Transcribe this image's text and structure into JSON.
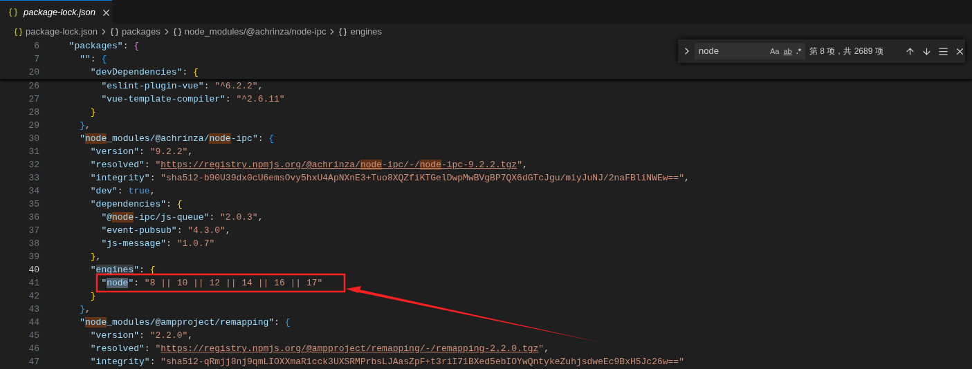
{
  "tab": {
    "label": "package-lock.json",
    "preview": true,
    "selected": true
  },
  "breadcrumbs": [
    {
      "label": "package-lock.json",
      "kind": "file"
    },
    {
      "label": "packages",
      "kind": "object"
    },
    {
      "label": "node_modules/@achrinza/node-ipc",
      "kind": "object"
    },
    {
      "label": "engines",
      "kind": "object"
    }
  ],
  "find_widget": {
    "value": "node",
    "options": [
      {
        "label": "Aa",
        "kind": "case",
        "on": false
      },
      {
        "label": "ab",
        "kind": "word",
        "on": false
      },
      {
        "label": ".*",
        "kind": "regex",
        "on": false
      }
    ],
    "result": "第 8 项，共 2689 项"
  },
  "sticky_lines": [
    {
      "number": "6",
      "active": false,
      "tokens": [
        {
          "kind": "key",
          "text": "  \"packages\""
        },
        {
          "kind": "punct",
          "text": ": "
        },
        {
          "kind": "brace",
          "text": "{",
          "color": "#da70d6"
        }
      ]
    },
    {
      "number": "7",
      "active": false,
      "tokens": [
        {
          "kind": "key",
          "text": "    \"\""
        },
        {
          "kind": "punct",
          "text": ": "
        },
        {
          "kind": "brace",
          "text": "{",
          "color": "#179fff"
        }
      ]
    },
    {
      "number": "20",
      "active": false,
      "tokens": [
        {
          "kind": "key",
          "text": "      \"devDependencies\""
        },
        {
          "kind": "punct",
          "text": ": "
        },
        {
          "kind": "brace",
          "text": "{",
          "color": "#ffd700"
        }
      ]
    }
  ],
  "lines": [
    {
      "number": "26",
      "active": false,
      "tokens": [
        {
          "kind": "key",
          "text": "        \"eslint-plugin-vue\""
        },
        {
          "kind": "punct",
          "text": ": "
        },
        {
          "kind": "string",
          "text": "\"^6.2.2\""
        },
        {
          "kind": "punct",
          "text": ","
        }
      ]
    },
    {
      "number": "27",
      "active": false,
      "tokens": [
        {
          "kind": "key",
          "text": "        \"vue-template-compiler\""
        },
        {
          "kind": "punct",
          "text": ": "
        },
        {
          "kind": "string",
          "text": "\"^2.6.11\""
        }
      ]
    },
    {
      "number": "28",
      "active": false,
      "tokens": [
        {
          "kind": "brace",
          "text": "      }",
          "color": "#ffd700"
        }
      ]
    },
    {
      "number": "29",
      "active": false,
      "tokens": [
        {
          "kind": "brace",
          "text": "    }",
          "color": "#179fff"
        },
        {
          "kind": "punct",
          "text": ","
        }
      ]
    },
    {
      "number": "30",
      "active": false,
      "tokens": [
        {
          "kind": "key",
          "text": "    \""
        },
        {
          "kind": "key",
          "text": "node",
          "match": true
        },
        {
          "kind": "key",
          "text": "_modules/@achrinza/"
        },
        {
          "kind": "key",
          "text": "node",
          "match": true
        },
        {
          "kind": "key",
          "text": "-ipc\""
        },
        {
          "kind": "punct",
          "text": ": "
        },
        {
          "kind": "brace",
          "text": "{",
          "color": "#179fff"
        }
      ]
    },
    {
      "number": "31",
      "active": false,
      "tokens": [
        {
          "kind": "key",
          "text": "      \"version\""
        },
        {
          "kind": "punct",
          "text": ": "
        },
        {
          "kind": "string",
          "text": "\"9.2.2\""
        },
        {
          "kind": "punct",
          "text": ","
        }
      ]
    },
    {
      "number": "32",
      "active": false,
      "tokens": [
        {
          "kind": "key",
          "text": "      \"resolved\""
        },
        {
          "kind": "punct",
          "text": ": "
        },
        {
          "kind": "string",
          "text": "\""
        },
        {
          "kind": "link",
          "text": "https://registry.npmjs.org/@achrinza/"
        },
        {
          "kind": "link",
          "text": "node",
          "match": true
        },
        {
          "kind": "link",
          "text": "-ipc/-/"
        },
        {
          "kind": "link",
          "text": "node",
          "match": true
        },
        {
          "kind": "link",
          "text": "-ipc-9.2.2.tgz"
        },
        {
          "kind": "string",
          "text": "\""
        },
        {
          "kind": "punct",
          "text": ","
        }
      ]
    },
    {
      "number": "33",
      "active": false,
      "tokens": [
        {
          "kind": "key",
          "text": "      \"integrity\""
        },
        {
          "kind": "punct",
          "text": ": "
        },
        {
          "kind": "string",
          "text": "\"sha512-b90U39dx0cU6emsOvy5hxU4ApNXnE3+Tuo8XQZfiKTGelDwpMwBVgBP7QX6dGTcJgu/miyJuNJ/2naFBliNWEw==\""
        },
        {
          "kind": "punct",
          "text": ","
        }
      ]
    },
    {
      "number": "34",
      "active": false,
      "tokens": [
        {
          "kind": "key",
          "text": "      \"dev\""
        },
        {
          "kind": "punct",
          "text": ": "
        },
        {
          "kind": "bool",
          "text": "true"
        },
        {
          "kind": "punct",
          "text": ","
        }
      ]
    },
    {
      "number": "35",
      "active": false,
      "tokens": [
        {
          "kind": "key",
          "text": "      \"dependencies\""
        },
        {
          "kind": "punct",
          "text": ": "
        },
        {
          "kind": "brace",
          "text": "{",
          "color": "#ffd700"
        }
      ]
    },
    {
      "number": "36",
      "active": false,
      "tokens": [
        {
          "kind": "key",
          "text": "        \"@"
        },
        {
          "kind": "key",
          "text": "node",
          "match": true
        },
        {
          "kind": "key",
          "text": "-ipc/js-queue\""
        },
        {
          "kind": "punct",
          "text": ": "
        },
        {
          "kind": "string",
          "text": "\"2.0.3\""
        },
        {
          "kind": "punct",
          "text": ","
        }
      ]
    },
    {
      "number": "37",
      "active": false,
      "tokens": [
        {
          "kind": "key",
          "text": "        \"event-pubsub\""
        },
        {
          "kind": "punct",
          "text": ": "
        },
        {
          "kind": "string",
          "text": "\"4.3.0\""
        },
        {
          "kind": "punct",
          "text": ","
        }
      ]
    },
    {
      "number": "38",
      "active": false,
      "tokens": [
        {
          "kind": "key",
          "text": "        \"js-message\""
        },
        {
          "kind": "punct",
          "text": ": "
        },
        {
          "kind": "string",
          "text": "\"1.0.7\""
        }
      ]
    },
    {
      "number": "39",
      "active": false,
      "tokens": [
        {
          "kind": "brace",
          "text": "      }",
          "color": "#ffd700"
        },
        {
          "kind": "punct",
          "text": ","
        }
      ]
    },
    {
      "number": "40",
      "active": true,
      "tokens": [
        {
          "kind": "key",
          "text": "      \""
        },
        {
          "kind": "key",
          "text": "engines",
          "selected": true
        },
        {
          "kind": "key",
          "text": "\""
        },
        {
          "kind": "punct",
          "text": ": "
        },
        {
          "kind": "brace",
          "text": "{",
          "color": "#ffd700"
        }
      ]
    },
    {
      "number": "41",
      "active": false,
      "tokens": [
        {
          "kind": "key",
          "text": "        \""
        },
        {
          "kind": "key",
          "text": "node",
          "current": true
        },
        {
          "kind": "key",
          "text": "\""
        },
        {
          "kind": "punct",
          "text": ": "
        },
        {
          "kind": "string",
          "text": "\"8 || 10 || 12 || 14 || 16 || 17\""
        }
      ]
    },
    {
      "number": "42",
      "active": false,
      "tokens": [
        {
          "kind": "brace",
          "text": "      }",
          "color": "#ffd700"
        }
      ]
    },
    {
      "number": "43",
      "active": false,
      "tokens": [
        {
          "kind": "brace",
          "text": "    }",
          "color": "#179fff"
        },
        {
          "kind": "punct",
          "text": ","
        }
      ]
    },
    {
      "number": "44",
      "active": false,
      "tokens": [
        {
          "kind": "key",
          "text": "    \""
        },
        {
          "kind": "key",
          "text": "node",
          "match": true
        },
        {
          "kind": "key",
          "text": "_modules/@ampproject/remapping\""
        },
        {
          "kind": "punct",
          "text": ": "
        },
        {
          "kind": "brace",
          "text": "{",
          "color": "#179fff"
        }
      ]
    },
    {
      "number": "45",
      "active": false,
      "tokens": [
        {
          "kind": "key",
          "text": "      \"version\""
        },
        {
          "kind": "punct",
          "text": ": "
        },
        {
          "kind": "string",
          "text": "\"2.2.0\""
        },
        {
          "kind": "punct",
          "text": ","
        }
      ]
    },
    {
      "number": "46",
      "active": false,
      "tokens": [
        {
          "kind": "key",
          "text": "      \"resolved\""
        },
        {
          "kind": "punct",
          "text": ": "
        },
        {
          "kind": "string",
          "text": "\""
        },
        {
          "kind": "link",
          "text": "https://registry.npmjs.org/@ampproject/remapping/-/remapping-2.2.0.tgz"
        },
        {
          "kind": "string",
          "text": "\""
        },
        {
          "kind": "punct",
          "text": ","
        }
      ]
    },
    {
      "number": "47",
      "active": false,
      "tokens": [
        {
          "kind": "key",
          "text": "      \"integrity\""
        },
        {
          "kind": "punct",
          "text": ": "
        },
        {
          "kind": "string",
          "text": "\"sha512-qRmjj8nj9qmLIOXXmaR1cck3UXSRMPrbsLJAasZpF+t3riI71BXed5ebIOYwQntykeZuhjsdweEc9BxH5Jc26w==\""
        }
      ]
    }
  ]
}
